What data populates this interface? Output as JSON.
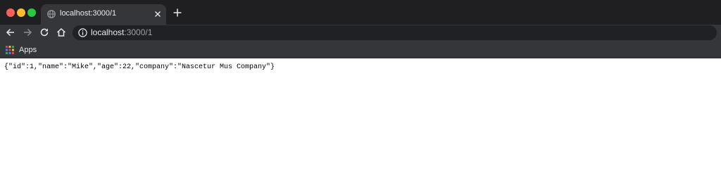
{
  "tab": {
    "title": "localhost:3000/1",
    "favicon": "globe-icon"
  },
  "toolbar": {
    "url_host": "localhost",
    "url_path": ":3000/1",
    "icons": [
      "back-arrow-icon",
      "forward-arrow-icon",
      "reload-icon",
      "home-icon",
      "info-icon"
    ]
  },
  "bookmarks": {
    "apps_label": "Apps"
  },
  "page": {
    "json_text": "{\"id\":1,\"name\":\"Mike\",\"age\":22,\"company\":\"Nascetur Mus Company\"}"
  },
  "colors": {
    "tabstrip": "#1f1f22",
    "toolbar": "#35363a",
    "omnibox": "#202124",
    "close": "#ff5f57",
    "minimize": "#febc2e",
    "maximize": "#28c840"
  }
}
